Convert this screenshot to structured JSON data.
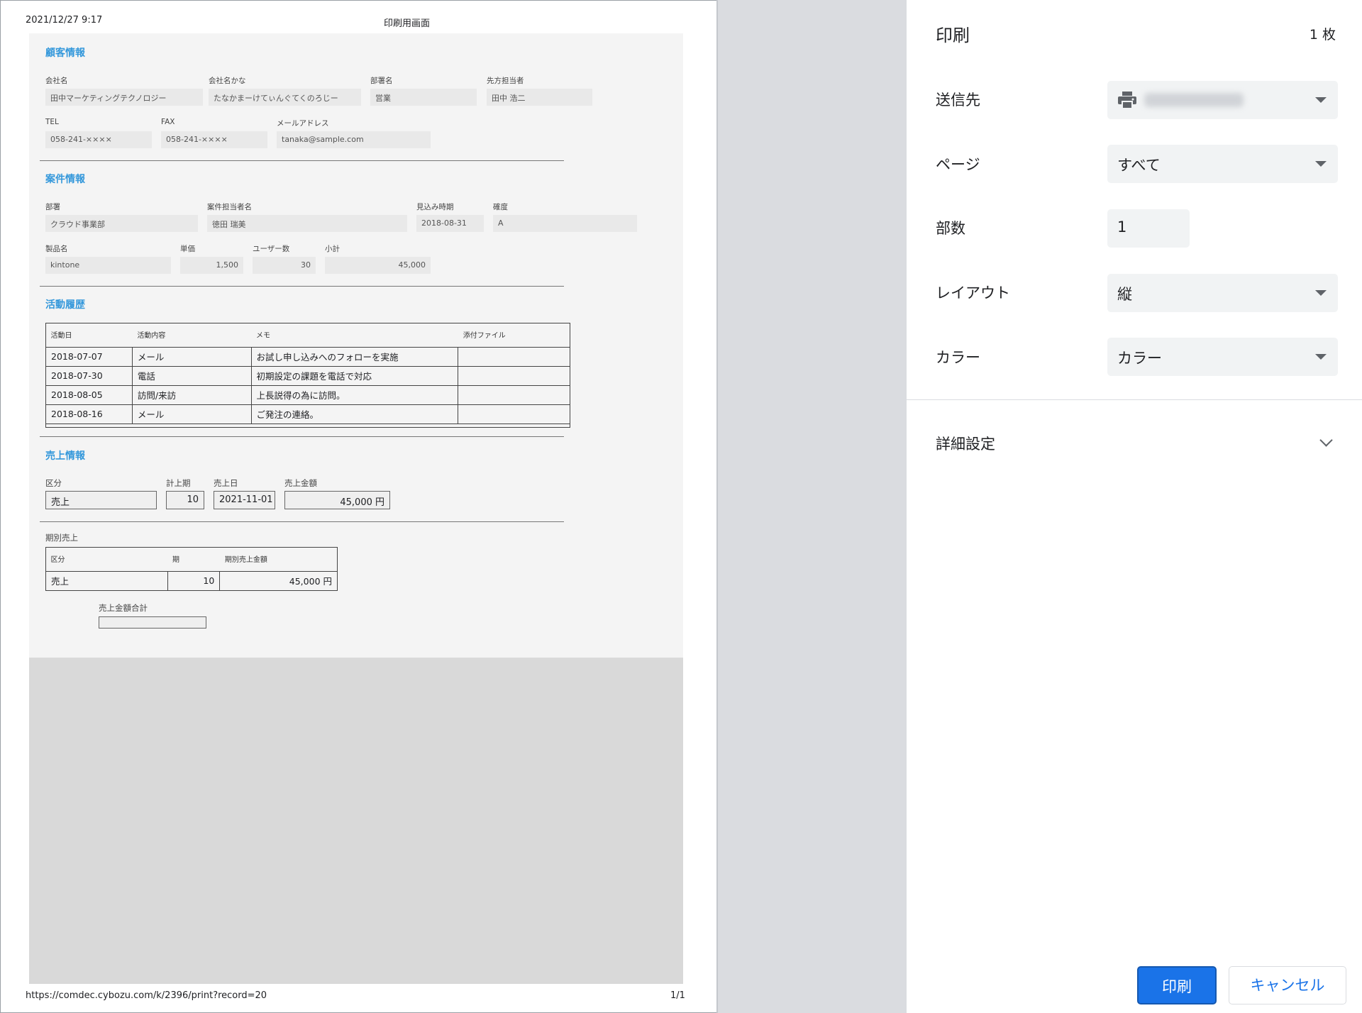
{
  "preview": {
    "header_date": "2021/12/27 9:17",
    "header_title": "印刷用画面",
    "footer_url": "https://comdec.cybozu.com/k/2396/print?record=20",
    "footer_page": "1/1"
  },
  "customer": {
    "title": "顧客情報",
    "company_label": "会社名",
    "company_value": "田中マーケティングテクノロジー",
    "kana_label": "会社名かな",
    "kana_value": "たなかまーけてぃんぐてくのろじー",
    "dept_label": "部署名",
    "dept_value": "営業",
    "contact_label": "先方担当者",
    "contact_value": "田中 浩二",
    "tel_label": "TEL",
    "tel_value": "058-241-××××",
    "fax_label": "FAX",
    "fax_value": "058-241-××××",
    "mail_label": "メールアドレス",
    "mail_value": "tanaka@sample.com"
  },
  "deal": {
    "title": "案件情報",
    "dept_label": "部署",
    "dept_value": "クラウド事業部",
    "owner_label": "案件担当者名",
    "owner_value": "徳田 瑞美",
    "forecast_label": "見込み時期",
    "forecast_value": "2018-08-31",
    "certainty_label": "確度",
    "certainty_value": "A",
    "product_label": "製品名",
    "product_value": "kintone",
    "price_label": "単価",
    "price_value": "1,500",
    "users_label": "ユーザー数",
    "users_value": "30",
    "subtotal_label": "小計",
    "subtotal_value": "45,000"
  },
  "activity": {
    "title": "活動履歴",
    "headers": [
      "活動日",
      "活動内容",
      "メモ",
      "添付ファイル"
    ],
    "rows": [
      [
        "2018-07-07",
        "メール",
        "お試し申し込みへのフォローを実施",
        ""
      ],
      [
        "2018-07-30",
        "電話",
        "初期設定の課題を電話で対応",
        ""
      ],
      [
        "2018-08-05",
        "訪問/来訪",
        "上長説得の為に訪問。",
        ""
      ],
      [
        "2018-08-16",
        "メール",
        "ご発注の連絡。",
        ""
      ]
    ]
  },
  "sales": {
    "title": "売上情報",
    "kubun_label": "区分",
    "kubun_value": "売上",
    "period_label": "計上期",
    "period_value": "10",
    "date_label": "売上日",
    "date_value": "2021-11-01",
    "amount_label": "売上金額",
    "amount_value": "45,000 円",
    "periodic_label": "期別売上",
    "periodic_headers": [
      "区分",
      "期",
      "期別売上金額"
    ],
    "periodic_row": [
      "売上",
      "10",
      "45,000 円"
    ],
    "total_label": "売上金額合計",
    "total_value": ""
  },
  "panel": {
    "title": "印刷",
    "sheet_count": "1 枚",
    "destination_label": "送信先",
    "pages_label": "ページ",
    "pages_value": "すべて",
    "copies_label": "部数",
    "copies_value": "1",
    "layout_label": "レイアウト",
    "layout_value": "縦",
    "color_label": "カラー",
    "color_value": "カラー",
    "more_settings": "詳細設定",
    "print_button": "印刷",
    "cancel_button": "キャンセル"
  },
  "colors": {
    "accent": "#1a73e8",
    "section_title": "#3498db",
    "panel_bg": "#ffffff",
    "preview_bg": "#dadce0"
  },
  "icons": {
    "printer": "printer-icon",
    "dropdown": "chevron-down-icon"
  }
}
